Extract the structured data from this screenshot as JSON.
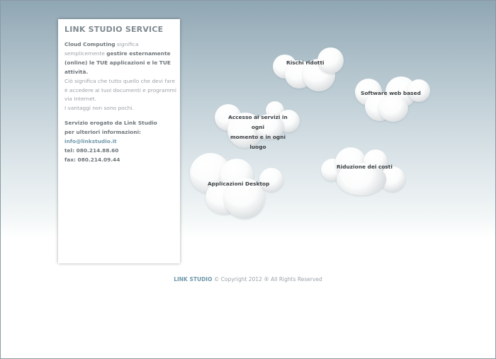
{
  "sidebar": {
    "title": "LINK STUDIO SERVICE",
    "intro_bold": "Cloud Computing",
    "intro_text": "significa semplicemente",
    "intro_bold2": "gestire esternamente (online) le TUE applicazioni e le TUE attività.",
    "para2": "Ciò significa che tutto quello che devi fare è accedere ai tuoi documenti e programmi via Internet.",
    "para3": "I vantaggi non sono pochi.",
    "service_line1": "Servizio erogato da Link Studio",
    "service_line2": "per ulteriori informazioni:",
    "email": "info@linkstudio.it",
    "tel": "tel: 080.214.88.60",
    "fax": "fax: 080.214.09.44"
  },
  "clouds": {
    "rischi": "Rischi ridotti",
    "software": "Software web based",
    "accesso_line1": "Accesso ai servizi in ogni",
    "accesso_line2": "momento e in ogni luogo",
    "riduzione": "Riduzione dei costi",
    "applicazioni": "Applicazioni Desktop"
  },
  "footer": {
    "brand": "LINK STUDIO",
    "copyright": "© Copyright 2012 ® All Rights Reserved"
  }
}
